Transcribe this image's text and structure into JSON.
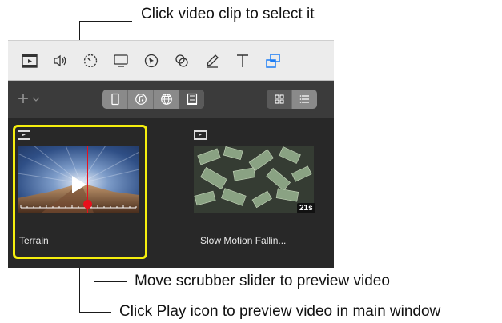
{
  "callouts": {
    "select_clip": "Click video clip to select it",
    "scrubber": "Move scrubber slider to preview video",
    "play": "Click Play icon to preview video in main window"
  },
  "toolbar": {
    "tools": [
      {
        "icon": "film-icon"
      },
      {
        "icon": "speaker-icon"
      },
      {
        "icon": "speed-dial-icon"
      },
      {
        "icon": "monitor-icon"
      },
      {
        "icon": "cursor-icon"
      },
      {
        "icon": "color-filter-icon"
      },
      {
        "icon": "pencil-icon"
      },
      {
        "icon": "text-icon"
      },
      {
        "icon": "transitions-icon"
      }
    ],
    "active_color": "#1a7cf5"
  },
  "library": {
    "add_label": "+",
    "sources": [
      {
        "icon": "iphone-icon",
        "active": false
      },
      {
        "icon": "music-icon",
        "active": false
      },
      {
        "icon": "globe-icon",
        "active": false
      },
      {
        "icon": "templates-icon",
        "active": true
      }
    ],
    "views": [
      {
        "icon": "grid-view-icon",
        "active": true
      },
      {
        "icon": "list-view-icon",
        "active": false
      }
    ]
  },
  "clips": [
    {
      "label": "Terrain",
      "selected": true,
      "duration": "",
      "scrubber_position": 0.58
    },
    {
      "label": "Slow Motion Fallin...",
      "selected": false,
      "duration": "21s"
    }
  ],
  "colors": {
    "selection": "#f5ee0e",
    "scrubber": "#e8101c",
    "panel_bg": "#282828"
  }
}
